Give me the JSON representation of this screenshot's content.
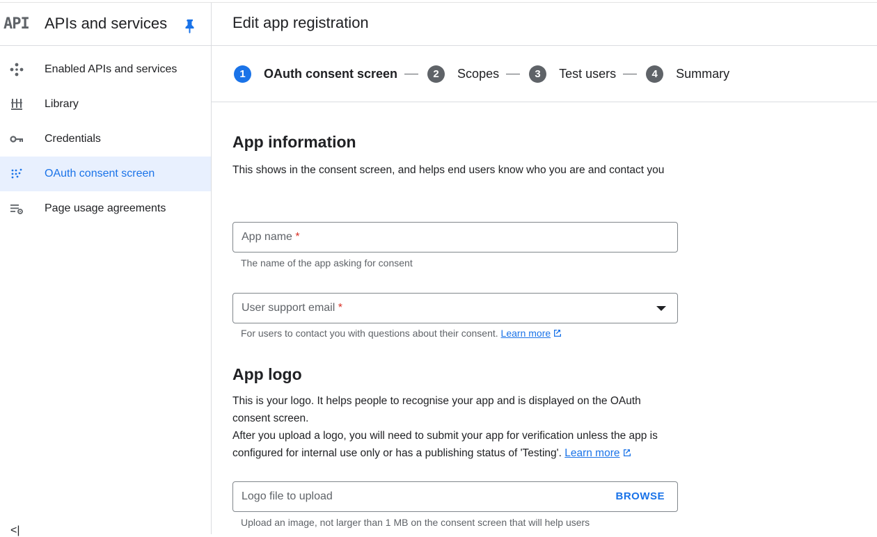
{
  "sidebar": {
    "logo_text": "API",
    "title": "APIs and services",
    "items": [
      {
        "label": "Enabled APIs and services",
        "icon": "diamond-arrows-icon"
      },
      {
        "label": "Library",
        "icon": "library-icon"
      },
      {
        "label": "Credentials",
        "icon": "key-icon"
      },
      {
        "label": "OAuth consent screen",
        "icon": "dots-grid-icon",
        "active": true
      },
      {
        "label": "Page usage agreements",
        "icon": "list-settings-icon"
      }
    ],
    "collapse_label": "<|"
  },
  "page": {
    "title": "Edit app registration"
  },
  "stepper": {
    "steps": [
      {
        "num": "1",
        "label": "OAuth consent screen",
        "active": true
      },
      {
        "num": "2",
        "label": "Scopes"
      },
      {
        "num": "3",
        "label": "Test users"
      },
      {
        "num": "4",
        "label": "Summary"
      }
    ]
  },
  "app_info": {
    "heading": "App information",
    "description": "This shows in the consent screen, and helps end users know who you are and contact you",
    "app_name": {
      "placeholder": "App name",
      "required_mark": "*",
      "helper": "The name of the app asking for consent"
    },
    "support_email": {
      "placeholder": "User support email",
      "required_mark": "*",
      "helper": "For users to contact you with questions about their consent.",
      "link": "Learn more"
    }
  },
  "app_logo": {
    "heading": "App logo",
    "description_1": "This is your logo. It helps people to recognise your app and is displayed on the OAuth consent screen.",
    "description_2": "After you upload a logo, you will need to submit your app for verification unless the app is configured for internal use only or has a publishing status of 'Testing'.",
    "link": "Learn more",
    "upload": {
      "placeholder": "Logo file to upload",
      "button": "BROWSE"
    },
    "helper": "Upload an image, not larger than 1 MB on the consent screen that will help users"
  },
  "colors": {
    "accent": "#1a73e8",
    "active_bg": "#e8f0fe",
    "required": "#d93025"
  }
}
